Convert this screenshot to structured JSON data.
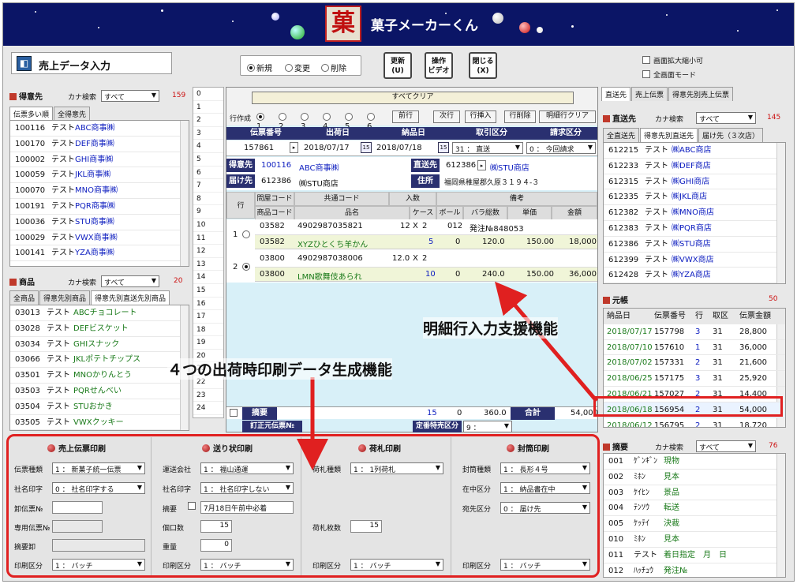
{
  "app": {
    "title": "菓子メーカーくん",
    "logo": "菓X",
    "screen_title": "売上データ入力"
  },
  "mode": {
    "options": [
      "新規",
      "変更",
      "削除"
    ],
    "selected": "新規"
  },
  "buttons": {
    "update": [
      "更新",
      "(U)"
    ],
    "video": [
      "操作",
      "ビデオ"
    ],
    "close": [
      "閉じる",
      "(X)"
    ]
  },
  "checks": {
    "zoom": "画面拡大縮小可",
    "full": "全画面モード"
  },
  "customer": {
    "title": "得意先",
    "kana_label": "カナ検索",
    "kana_value": "すべて",
    "count": "159",
    "tabs": [
      "伝票多い順",
      "全得意先"
    ],
    "rows": [
      [
        "100116",
        "テスト",
        "ABC商事㈱"
      ],
      [
        "100170",
        "テスト",
        "DEF商事㈱"
      ],
      [
        "100002",
        "テスト",
        "GHI商事㈱"
      ],
      [
        "100059",
        "テスト",
        "JKL商事㈱"
      ],
      [
        "100070",
        "テスト",
        "MNO商事㈱"
      ],
      [
        "100191",
        "テスト",
        "PQR商事㈱"
      ],
      [
        "100036",
        "テスト",
        "STU商事㈱"
      ],
      [
        "100029",
        "テスト",
        "VWX商事㈱"
      ],
      [
        "100141",
        "テスト",
        "YZA商事㈱"
      ]
    ]
  },
  "product": {
    "title": "商品",
    "kana_label": "カナ検索",
    "kana_value": "すべて",
    "count": "20",
    "tabs": [
      "全商品",
      "得意先別商品",
      "得意先別直送先別商品"
    ],
    "rows": [
      [
        "03013",
        "テスト",
        "ABCチョコレート"
      ],
      [
        "03028",
        "テスト",
        "DEFビスケット"
      ],
      [
        "03034",
        "テスト",
        "GHIスナック"
      ],
      [
        "03066",
        "テスト",
        "JKLポテトチップス"
      ],
      [
        "03501",
        "テスト",
        "MNOかりんとう"
      ],
      [
        "03503",
        "テスト",
        "PQRせんべい"
      ],
      [
        "03504",
        "テスト",
        "STUおかき"
      ],
      [
        "03505",
        "テスト",
        "VWXクッキー"
      ]
    ]
  },
  "rownums": [
    "0",
    "1",
    "2",
    "3",
    "4",
    "5",
    "6",
    "7",
    "8",
    "9",
    "10",
    "11",
    "12",
    "13",
    "14",
    "15",
    "16",
    "17",
    "18",
    "19",
    "20",
    "21",
    "22",
    "23",
    "24"
  ],
  "center": {
    "clear_all": "すべてクリア",
    "row_op_label": "行作成",
    "row_op_nums": [
      "1",
      "2",
      "3",
      "4",
      "5",
      "6"
    ],
    "row_buttons": [
      "前行",
      "次行",
      "行挿入",
      "行削除",
      "明細行クリア"
    ],
    "head_labels": [
      "伝票番号",
      "出荷日",
      "納品日",
      "取引区分",
      "請求区分"
    ],
    "head_values": {
      "slip": "157861",
      "ship": "2018/07/17",
      "deliver": "2018/07/18",
      "trade": "31 ： 直送",
      "bill": "0 ： 今回請求"
    },
    "tokui_label": "得意先",
    "tokui_code": "100116",
    "tokui_name": "ABC商事㈱",
    "direct_label": "直送先",
    "direct_code": "612386",
    "direct_name": "㈱STU商店",
    "todoke_label": "届け先",
    "todoke_code": "612386",
    "todoke_name": "㈱STU商店",
    "addr_label": "住所",
    "addr_value": "福岡県稚屋郡久原３１９４-３",
    "detail_head1": [
      "行",
      "問屋コード",
      "共通コード",
      "入数",
      "備考"
    ],
    "detail_head2": [
      "商品コード",
      "品名",
      "ケース",
      "ボール",
      "バラ総数",
      "単価",
      "金額"
    ],
    "lines": [
      {
        "no": "1",
        "wholesale": "03582",
        "jan": "4902987035821",
        "irisu_case": "12",
        "irisu_ball": "2",
        "memo_ball": "012",
        "memo": "発注№848053",
        "code": "03582",
        "name": "XYZひとくち羊かん",
        "case": "5",
        "ball": "0",
        "bara": "120.0",
        "price": "150.00",
        "amount": "18,000"
      },
      {
        "no": "2",
        "wholesale": "03800",
        "jan": "4902987038006",
        "irisu_case": "12.0",
        "irisu_ball": "2",
        "memo_ball": "",
        "memo": "",
        "code": "03800",
        "name": "LMN歌舞伎あられ",
        "case": "10",
        "ball": "0",
        "bara": "240.0",
        "price": "150.00",
        "amount": "36,000"
      }
    ],
    "times": "X",
    "summary_label": "摘要",
    "sum_case": "15",
    "sum_ball": "0",
    "sum_bara": "360.0",
    "total_label": "合計",
    "total": "54,000",
    "correction_label": "訂正元伝票№",
    "fixed_label": "定番特売区分",
    "fixed_value": "9 ："
  },
  "callouts": {
    "detail": "明細行入力支援機能",
    "print": "４つの出荷時印刷データ生成機能"
  },
  "print": {
    "slip": {
      "title": "売上伝票印刷",
      "fields": [
        [
          "伝票種類",
          "1 ： 新菓子統一伝票"
        ],
        [
          "社名印字",
          "0 ： 社名印字する"
        ],
        [
          "卸伝票№",
          ""
        ],
        [
          "専用伝票№",
          ""
        ],
        [
          "摘要卸",
          ""
        ],
        [
          "印刷区分",
          "1 ： バッチ"
        ]
      ]
    },
    "invoice": {
      "title": "送り状印刷",
      "carrier_label": "運送会社",
      "carrier": "1 ： 福山通運",
      "name_label": "社名印字",
      "name": "1 ： 社名印字しない",
      "memo_label": "摘要",
      "memo": "7月18日午前中必着",
      "count_label": "個口数",
      "count": "15",
      "weight_label": "重量",
      "weight": "0",
      "print_label": "印刷区分",
      "print": "1 ： バッチ"
    },
    "tag": {
      "title": "荷札印刷",
      "kind_label": "荷札種類",
      "kind": "1 ： 1列荷札",
      "count_label": "荷札枚数",
      "count": "15",
      "print_label": "印刷区分",
      "print": "1 ： バッチ"
    },
    "envelope": {
      "title": "封筒印刷",
      "kind_label": "封筒種類",
      "kind": "1 ： 長形４号",
      "stock_label": "在中区分",
      "stock": "1 ： 納品書在中",
      "addr_label": "宛先区分",
      "addr": "0 ： 届け先",
      "print_label": "印刷区分",
      "print": "1 ： バッチ"
    }
  },
  "direct": {
    "tabs1": [
      "直送先",
      "売上伝票",
      "得意先別売上伝票"
    ],
    "title": "直送先",
    "kana_label": "カナ検索",
    "kana_value": "すべて",
    "count": "145",
    "tabs2": [
      "全直送先",
      "得意先別直送先",
      "届け先（３次店）"
    ],
    "rows": [
      [
        "612215",
        "テスト",
        "㈱ABC商店"
      ],
      [
        "612233",
        "テスト",
        "㈱DEF商店"
      ],
      [
        "612315",
        "テスト",
        "㈱GHI商店"
      ],
      [
        "612335",
        "テスト",
        "㈱JKL商店"
      ],
      [
        "612382",
        "テスト",
        "㈱MNO商店"
      ],
      [
        "612383",
        "テスト",
        "㈱PQR商店"
      ],
      [
        "612386",
        "テスト",
        "㈱STU商店"
      ],
      [
        "612399",
        "テスト",
        "㈱VWX商店"
      ],
      [
        "612428",
        "テスト",
        "㈱YZA商店"
      ]
    ]
  },
  "ledger": {
    "title": "元帳",
    "count": "50",
    "heads": [
      "納品日",
      "伝票番号",
      "行",
      "取区",
      "伝票金額"
    ],
    "rows": [
      [
        "2018/07/17",
        "157798",
        "3",
        "31",
        "28,800"
      ],
      [
        "2018/07/10",
        "157610",
        "1",
        "31",
        "36,000"
      ],
      [
        "2018/07/02",
        "157331",
        "2",
        "31",
        "21,600"
      ],
      [
        "2018/06/25",
        "157175",
        "3",
        "31",
        "25,920"
      ],
      [
        "2018/06/21",
        "157027",
        "2",
        "31",
        "14,400"
      ],
      [
        "2018/06/18",
        "156954",
        "2",
        "31",
        "54,000"
      ],
      [
        "2018/06/12",
        "156795",
        "2",
        "31",
        "18,720"
      ]
    ]
  },
  "memo": {
    "title": "摘要",
    "kana_label": "カナ検索",
    "kana_value": "すべて",
    "count": "76",
    "rows": [
      [
        "001",
        "ｹﾞﾝｷﾞﾝ",
        "現物"
      ],
      [
        "002",
        "ﾐﾎﾝ",
        "見本"
      ],
      [
        "003",
        "ｹｲﾋﾝ",
        "景品"
      ],
      [
        "004",
        "ﾃﾝｿｳ",
        "転送"
      ],
      [
        "005",
        "ｹｯﾃｲ",
        "決裁"
      ],
      [
        "010",
        "ﾐﾎﾝ",
        "見本"
      ],
      [
        "011",
        "テスト",
        "着日指定　月　日"
      ],
      [
        "012",
        "ﾊｯﾁｭｳ",
        "発注№"
      ]
    ]
  },
  "colors": {
    "navy": "#2a3070",
    "red": "#e02020",
    "link": "#1020c0",
    "green": "#1a7a1a"
  }
}
